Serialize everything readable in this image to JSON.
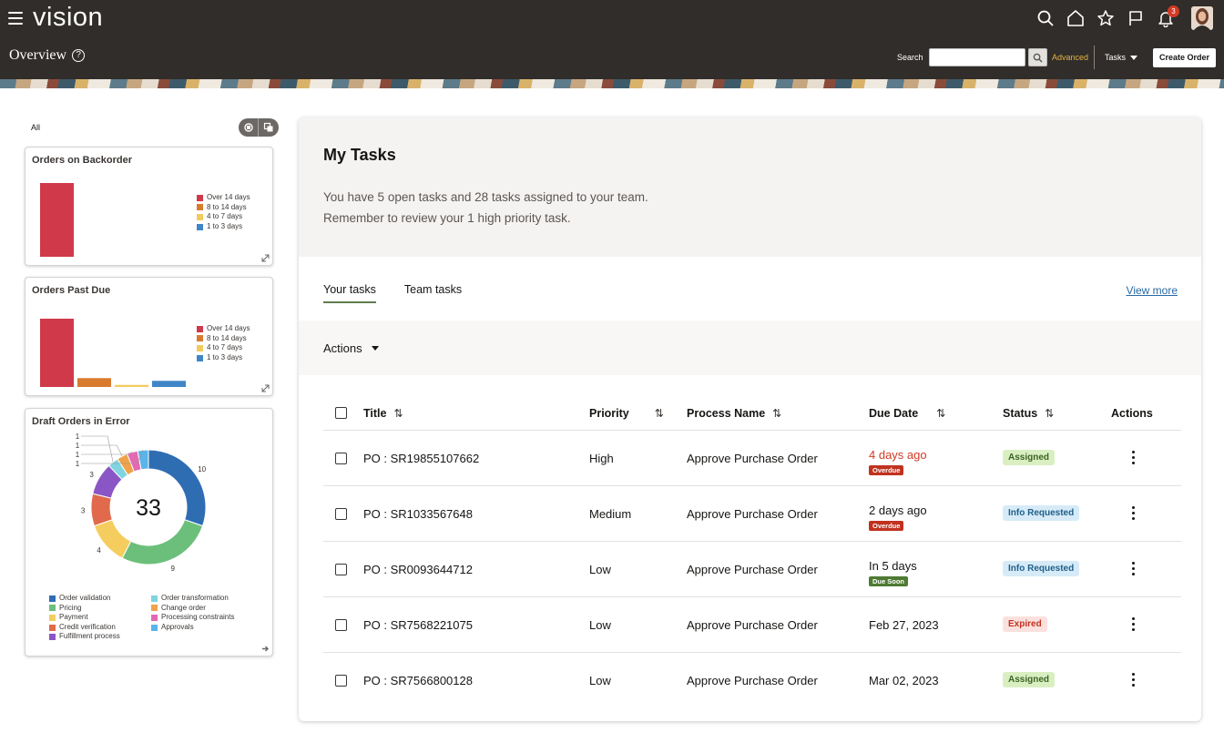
{
  "app": {
    "brand": "vision",
    "notification_count": "3"
  },
  "header": {
    "page_title": "Overview",
    "help_glyph": "?",
    "search_label": "Search",
    "search_value": "",
    "advanced_label": "Advanced",
    "tasks_label": "Tasks",
    "create_order_label": "Create Order",
    "icons": [
      "menu-icon",
      "search-icon",
      "home-icon",
      "star-icon",
      "flag-icon",
      "bell-icon",
      "avatar"
    ]
  },
  "sidebar": {
    "filter_label": "All",
    "cards": [
      {
        "title": "Orders on Backorder",
        "legend": [
          "Over 14 days",
          "8 to 14 days",
          "4 to 7 days",
          "1 to 3 days"
        ]
      },
      {
        "title": "Orders Past Due",
        "legend": [
          "Over 14 days",
          "8 to 14 days",
          "4 to 7 days",
          "1 to 3 days"
        ]
      },
      {
        "title": "Draft Orders in Error",
        "total": "33",
        "legend_left": [
          "Order validation",
          "Pricing",
          "Payment",
          "Credit verification",
          "Fulfillment process"
        ],
        "legend_right": [
          "Order transformation",
          "Change order",
          "Processing constraints",
          "Approvals"
        ]
      }
    ]
  },
  "chart_data": [
    {
      "type": "bar",
      "title": "Orders on Backorder",
      "categories": [
        "Over 14 days",
        "8 to 14 days",
        "4 to 7 days",
        "1 to 3 days"
      ],
      "values": [
        100,
        0,
        0,
        0
      ],
      "colors": [
        "#d0394a",
        "#d97b2f",
        "#f2cb5c",
        "#3e86c6"
      ]
    },
    {
      "type": "bar",
      "title": "Orders Past Due",
      "categories": [
        "Over 14 days",
        "8 to 14 days",
        "4 to 7 days",
        "1 to 3 days"
      ],
      "values": [
        100,
        13,
        3,
        9
      ],
      "colors": [
        "#d0394a",
        "#d97b2f",
        "#f2cb5c",
        "#3e86c6"
      ]
    },
    {
      "type": "pie",
      "title": "Draft Orders in Error",
      "total_label": "33",
      "slices": [
        {
          "label": "Order validation",
          "value": 10,
          "color": "#2f6db3"
        },
        {
          "label": "Pricing",
          "value": 9,
          "color": "#6cbf7a"
        },
        {
          "label": "Payment",
          "value": 4,
          "color": "#f5cd5f"
        },
        {
          "label": "Credit verification",
          "value": 3,
          "color": "#e06a4b"
        },
        {
          "label": "Fulfillment process",
          "value": 3,
          "color": "#8a55c4"
        },
        {
          "label": "Order transformation",
          "value": 1,
          "color": "#7fd4e0"
        },
        {
          "label": "Change order",
          "value": 1,
          "color": "#f0a24a"
        },
        {
          "label": "Processing constraints",
          "value": 1,
          "color": "#e26ab3"
        },
        {
          "label": "Approvals",
          "value": 1,
          "color": "#5ab4e8"
        }
      ]
    }
  ],
  "main": {
    "title": "My Tasks",
    "desc_line1": "You have 5 open tasks and 28 tasks assigned to your team.",
    "desc_line2": "Remember to review your 1 high priority task.",
    "tabs": [
      {
        "label": "Your tasks",
        "active": true
      },
      {
        "label": "Team tasks",
        "active": false
      }
    ],
    "view_more": "View more",
    "actions_label": "Actions",
    "sort_glyph": "⇅",
    "columns": {
      "title": "Title",
      "priority": "Priority",
      "process": "Process Name",
      "due": "Due Date",
      "status": "Status",
      "actions": "Actions"
    },
    "rows": [
      {
        "title": "PO : SR19855107662",
        "priority": "High",
        "process": "Approve Purchase Order",
        "due": "4 days ago",
        "due_tag": "Overdue",
        "status": "Assigned"
      },
      {
        "title": "PO : SR1033567648",
        "priority": "Medium",
        "process": "Approve Purchase Order",
        "due": "2 days ago",
        "due_tag": "Overdue",
        "status": "Info Requested"
      },
      {
        "title": "PO : SR0093644712",
        "priority": "Low",
        "process": "Approve Purchase Order",
        "due": "In 5 days",
        "due_tag": "Due Soon",
        "status": "Info Requested"
      },
      {
        "title": "PO : SR7568221075",
        "priority": "Low",
        "process": "Approve Purchase Order",
        "due": "Feb 27, 2023",
        "due_tag": "",
        "status": "Expired"
      },
      {
        "title": "PO : SR7566800128",
        "priority": "Low",
        "process": "Approve Purchase Order",
        "due": "Mar 02, 2023",
        "due_tag": "",
        "status": "Assigned"
      }
    ]
  }
}
